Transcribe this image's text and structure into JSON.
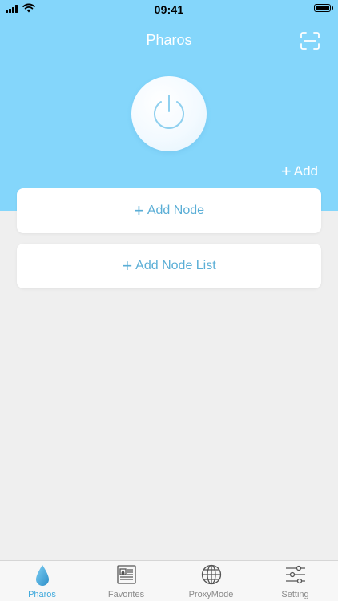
{
  "status_bar": {
    "time": "09:41"
  },
  "nav": {
    "title": "Pharos",
    "scan_icon": "scan-icon"
  },
  "power": {
    "icon": "power-icon"
  },
  "add": {
    "label": "Add"
  },
  "cards": [
    {
      "label": "Add Node"
    },
    {
      "label": "Add Node List"
    }
  ],
  "tabs": [
    {
      "label": "Pharos",
      "icon": "droplet-icon",
      "active": true
    },
    {
      "label": "Favorites",
      "icon": "newspaper-icon",
      "active": false
    },
    {
      "label": "ProxyMode",
      "icon": "globe-icon",
      "active": false
    },
    {
      "label": "Setting",
      "icon": "sliders-icon",
      "active": false
    }
  ],
  "colors": {
    "header_bg": "#84d6fb",
    "accent": "#3fa9dc",
    "card_text": "#5aaed6",
    "page_bg": "#efefef"
  }
}
